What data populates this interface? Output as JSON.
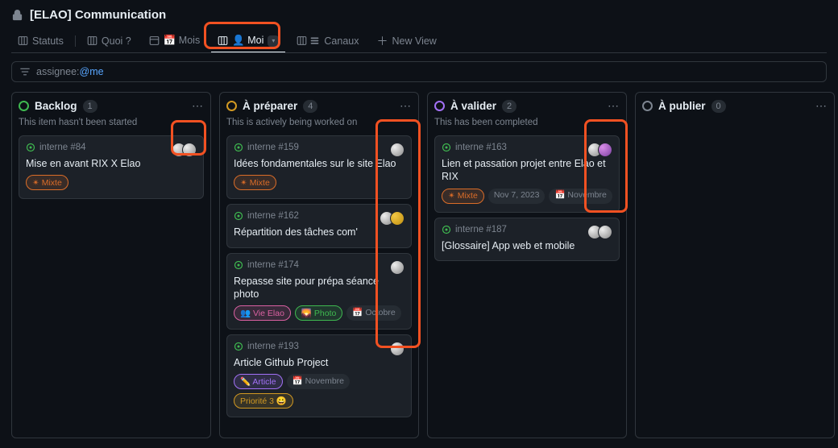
{
  "page": {
    "title": "[ELAO] Communication"
  },
  "tabs": {
    "statuts": "Statuts",
    "quoi": "Quoi ?",
    "mois": "📅 Mois",
    "moi": "👤 Moi",
    "canaux": "Canaux",
    "new_view": "New View"
  },
  "filter": {
    "field": "assignee:",
    "value": "@me"
  },
  "columns": [
    {
      "key": "backlog",
      "title": "Backlog",
      "count": "1",
      "desc": "This item hasn't been started",
      "dot_color": "#3fb950",
      "cards": [
        {
          "ref": "interne #84",
          "title": "Mise en avant RIX X Elao",
          "labels": [
            {
              "text": "✴︎ Mixte",
              "color": "#db6d28"
            }
          ],
          "avatars": 2
        }
      ]
    },
    {
      "key": "a_preparer",
      "title": "À préparer",
      "count": "4",
      "desc": "This is actively being worked on",
      "dot_color": "#d29922",
      "cards": [
        {
          "ref": "interne #159",
          "title": "Idées fondamentales sur le site Elao",
          "labels": [
            {
              "text": "✴︎ Mixte",
              "color": "#db6d28"
            }
          ],
          "avatars": 1
        },
        {
          "ref": "interne #162",
          "title": "Répartition des tâches com'",
          "labels": [],
          "avatars": 2,
          "avatar_alt": true
        },
        {
          "ref": "interne #174",
          "title": "Repasse site pour prépa séance photo",
          "labels": [
            {
              "text": "👥 Vie Elao",
              "color": "#db61a2"
            },
            {
              "text": "🌄 Photo",
              "color": "#3fb950"
            },
            {
              "text": "📅 Octobre",
              "color": "#7d8590",
              "bg": true
            }
          ],
          "avatars": 1
        },
        {
          "ref": "interne #193",
          "title": "Article Github Project",
          "labels": [
            {
              "text": "✏️ Article",
              "color": "#a371f7"
            },
            {
              "text": "📅 Novembre",
              "color": "#7d8590",
              "bg": true
            },
            {
              "text": "Priorité 3 😀",
              "color": "#d29922"
            }
          ],
          "avatars": 1
        }
      ]
    },
    {
      "key": "a_valider",
      "title": "À valider",
      "count": "2",
      "desc": "This has been completed",
      "dot_color": "#a371f7",
      "cards": [
        {
          "ref": "interne #163",
          "title": "Lien et passation projet entre Elao et RIX",
          "labels": [
            {
              "text": "✴︎ Mixte",
              "color": "#db6d28"
            }
          ],
          "date": "Nov 7, 2023",
          "extra_chip": "📅 Novembre",
          "avatars": 2,
          "avatar_alt2": true
        },
        {
          "ref": "interne #187",
          "title": "[Glossaire] App web et mobile",
          "labels": [],
          "avatars": 2
        }
      ]
    },
    {
      "key": "a_publier",
      "title": "À publier",
      "count": "0",
      "desc": "",
      "dot_color": "#7d8590",
      "cards": []
    }
  ]
}
